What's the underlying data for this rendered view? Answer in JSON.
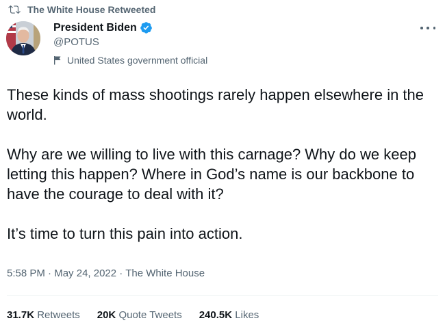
{
  "social_context": {
    "text": "The White House Retweeted"
  },
  "author": {
    "display_name": "President Biden",
    "handle": "@POTUS",
    "label": "United States government official",
    "verified_color": "#1d9bf0"
  },
  "tweet": {
    "paragraphs": [
      "These kinds of mass shootings rarely happen elsewhere in the world.",
      "Why are we willing to live with this carnage? Why do we keep letting this happen? Where in God’s name is our backbone to have the courage to deal with it?",
      "It’s time to turn this pain into action."
    ],
    "time": "5:58 PM",
    "date": "May 24, 2022",
    "source": "The White House"
  },
  "stats": {
    "retweets_count": "31.7K",
    "retweets_label": "Retweets",
    "quotes_count": "20K",
    "quotes_label": "Quote Tweets",
    "likes_count": "240.5K",
    "likes_label": "Likes"
  },
  "icons": {
    "retweet": "retweet-icon",
    "verified": "verified-badge-icon",
    "flag": "flag-icon",
    "more": "more-icon"
  }
}
